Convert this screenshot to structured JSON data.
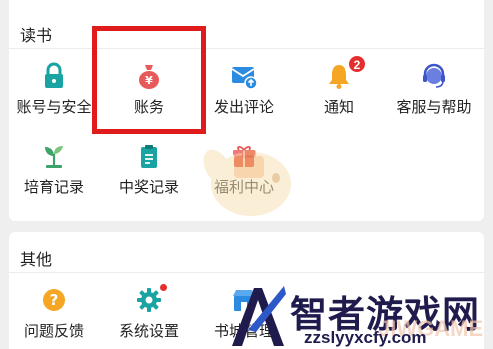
{
  "sections": {
    "reading": {
      "title": "读书",
      "items": [
        {
          "label": "账号与安全",
          "icon": "lock-icon"
        },
        {
          "label": "账务",
          "icon": "money-bag-icon"
        },
        {
          "label": "发出评论",
          "icon": "comment-send-icon"
        },
        {
          "label": "通知",
          "icon": "bell-icon",
          "badge": "2"
        },
        {
          "label": "客服与帮助",
          "icon": "headset-icon"
        },
        {
          "label": "培育记录",
          "icon": "sprout-icon"
        },
        {
          "label": "中奖记录",
          "icon": "prize-clipboard-icon"
        },
        {
          "label": "福利中心",
          "icon": "gift-icon"
        }
      ]
    },
    "other": {
      "title": "其他",
      "items": [
        {
          "label": "问题反馈",
          "icon": "question-icon"
        },
        {
          "label": "系统设置",
          "icon": "gear-icon",
          "dot": true
        },
        {
          "label": "书城管理",
          "icon": "store-icon"
        }
      ]
    }
  },
  "watermark": {
    "title": "智者游戏网",
    "url": "zzslyyxcfy.com",
    "ghost_text": "JIWGAME"
  },
  "colors": {
    "teal": "#1aa3a3",
    "red": "#e85a5a",
    "blue": "#2a8be0",
    "orange": "#f5a623",
    "green": "#3ea36a",
    "badge": "#e52f2f",
    "highlight": "#e01b1b"
  }
}
